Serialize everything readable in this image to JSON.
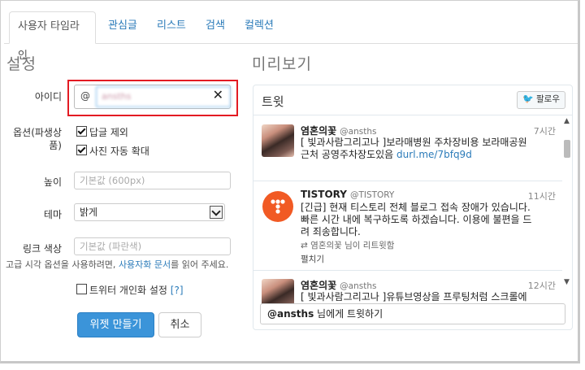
{
  "tabs": [
    {
      "label": "사용자 타임라인"
    },
    {
      "label": "관심글"
    },
    {
      "label": "리스트"
    },
    {
      "label": "검색"
    },
    {
      "label": "컬렉션"
    }
  ],
  "settings": {
    "title": "설정",
    "id_label": "아이디",
    "id_at": "@",
    "id_value": "ansths",
    "options_label": "옵션(파생상품)",
    "options_label_line1": "옵션(파생상",
    "options_label_line2": "품)",
    "exclude_replies": {
      "label": "답글 제외",
      "checked": true
    },
    "expand_photos": {
      "label": "사진 자동 확대",
      "checked": true
    },
    "height_label": "높이",
    "height_placeholder": "기본값 (600px)",
    "theme_label": "테마",
    "theme_value": "밝게",
    "link_color_label": "링크 색상",
    "link_color_placeholder": "기본값 (파란색)",
    "hint_prefix": "고급 시각 옵션을 사용하려면,",
    "hint_link": "사용자화 문서",
    "hint_suffix": "를 읽어 주세요.",
    "personalize": {
      "label": "트위터 개인화 설정",
      "help": "[?]",
      "checked": false
    },
    "create_button": "위젯 만들기",
    "cancel_button": "취소"
  },
  "preview": {
    "title": "미리보기",
    "header": "트윗",
    "follow_button": "팔로우",
    "tweets": [
      {
        "name": "염혼의꽃",
        "handle": "@ansths",
        "time": "7시간",
        "text_line1": "[ 빛과사람그리고나 ]보라매병원 주차장비용 보라매공원",
        "text_line2": "근처 공영주차장도있음",
        "link": "durl.me/7bfq9d"
      },
      {
        "name": "TISTORY",
        "handle": "@TISTORY",
        "time": "11시간",
        "text_line1": "[긴급] 현재 티스토리 전체 블로그 접속 장애가 있습니다.",
        "text_line2": "빠른 시간 내에 복구하도록 하겠습니다. 이용에 불편을 드",
        "text_line3": "려 죄송합니다.",
        "retweeted": "염혼의꽃 님이 리트윗함",
        "expand": "펼치기"
      },
      {
        "name": "염혼의꽃",
        "handle": "@ansths",
        "time": "12시간",
        "text_line1": "[ 빛과사람그리고나 ]유튜브영상을 프루팅처럼 스크롤에"
      }
    ],
    "reply_handle": "@ansths",
    "reply_suffix": " 님에게 트윗하기"
  }
}
